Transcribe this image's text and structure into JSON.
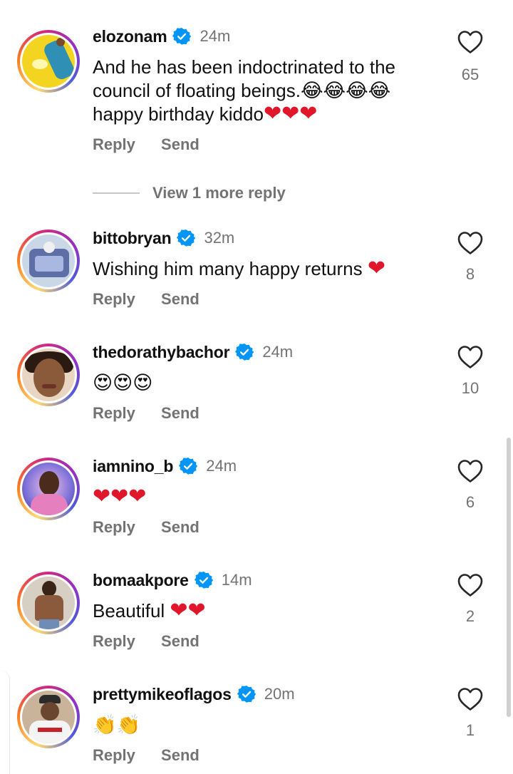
{
  "comments": [
    {
      "username": "elozonam",
      "time": "24m",
      "text_lines": [
        "And he has been indoctrinated to the",
        "council of floating beings.",
        "happy birthday kiddo"
      ],
      "emojis_line2": "😂😂😂😂",
      "emojis_line3": "❤❤❤",
      "likes": "65",
      "reply": "Reply",
      "send": "Send"
    },
    {
      "username": "bittobryan",
      "time": "32m",
      "text": "Wishing him many happy returns ",
      "emojis": "❤",
      "likes": "8",
      "reply": "Reply",
      "send": "Send"
    },
    {
      "username": "thedorathybachor",
      "time": "24m",
      "emojis": "😍😍😍",
      "likes": "10",
      "reply": "Reply",
      "send": "Send"
    },
    {
      "username": "iamnino_b",
      "time": "24m",
      "emojis": "❤❤❤",
      "likes": "6",
      "reply": "Reply",
      "send": "Send"
    },
    {
      "username": "bomaakpore",
      "time": "14m",
      "text": "Beautiful ",
      "emojis": "❤❤",
      "likes": "2",
      "reply": "Reply",
      "send": "Send"
    },
    {
      "username": "prettymikeoflagos",
      "time": "20m",
      "emojis": "👏👏",
      "likes": "1",
      "reply": "Reply",
      "send": "Send"
    }
  ],
  "view_more": "View 1 more reply",
  "colors": {
    "verified": "#0095f6",
    "heart_emoji": "#e0162b",
    "muted_text": "#737373"
  },
  "icons": [
    "verified-badge-icon",
    "heart-outline-icon"
  ]
}
